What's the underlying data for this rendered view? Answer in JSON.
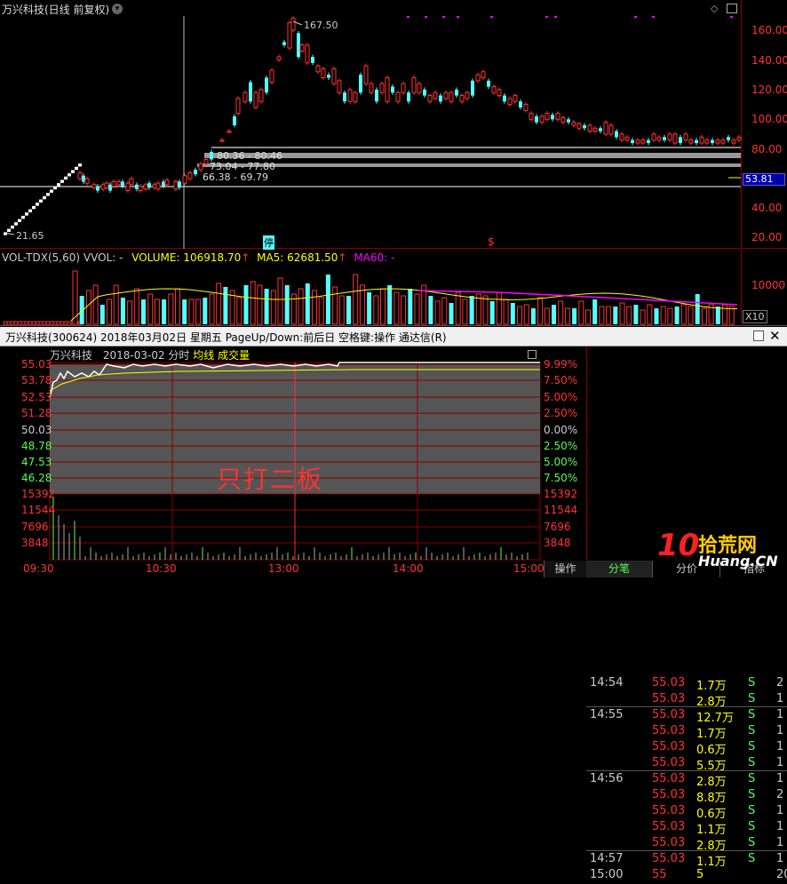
{
  "top": {
    "title": "万兴科技(日线 前复权)",
    "y_axis_ticks": [
      "160.00",
      "140.00",
      "120.00",
      "100.00",
      "80.00",
      "60.00",
      "40.00",
      "20.00"
    ],
    "last_price_tag": "53.81",
    "annotations": {
      "high": "167.50",
      "low": "21.65",
      "gap1": "80.36 - 80.46",
      "gap2": "73.04 - 77.80",
      "gap3": "66.38 - 69.79"
    },
    "markers": {
      "stop": "停",
      "dollar": "$"
    }
  },
  "volume": {
    "label_name": "VOL-TDX(5,60)",
    "label_vvol": "VVOL: -",
    "label_volume": "VOLUME: 106918.70",
    "label_ma5": "MA5: 62681.50",
    "label_ma60": "MA60: -",
    "y_tick": "10000",
    "unit": "X10"
  },
  "window": {
    "title": "万兴科技(300624) 2018年03月02日 星期五 PageUp/Down:前后日 空格键:操作 通达信(R)"
  },
  "intraday": {
    "stock": "万兴科技",
    "date_label": "2018-03-02 分时",
    "avg_label": "均线",
    "vol_label": "成交量",
    "watermark": "只打二板",
    "left_ticks": [
      "55.03",
      "53.78",
      "52.53",
      "51.28",
      "50.03",
      "48.78",
      "47.53",
      "46.28",
      "15392",
      "11544",
      "7696",
      "3848"
    ],
    "right_ticks": [
      "9.99%",
      "7.50%",
      "5.00%",
      "2.50%",
      "0.00%",
      "2.50%",
      "5.00%",
      "7.50%",
      "15392",
      "11544",
      "7696",
      "3848"
    ],
    "time_ticks": [
      "09:30",
      "10:30",
      "13:00",
      "14:00",
      "15:00"
    ],
    "bottom_tab": "操作"
  },
  "trades": {
    "rows": [
      {
        "time": "14:54",
        "price": "55.03",
        "vol": "1.7万",
        "side": "S",
        "n": "2"
      },
      {
        "time": "",
        "price": "55.03",
        "vol": "2.8万",
        "side": "S",
        "n": "1"
      },
      {
        "time": "14:55",
        "price": "55.03",
        "vol": "12.7万",
        "side": "S",
        "n": "1"
      },
      {
        "time": "",
        "price": "55.03",
        "vol": "1.7万",
        "side": "S",
        "n": "1"
      },
      {
        "time": "",
        "price": "55.03",
        "vol": "0.6万",
        "side": "S",
        "n": "1"
      },
      {
        "time": "",
        "price": "55.03",
        "vol": "5.5万",
        "side": "S",
        "n": "1"
      },
      {
        "time": "14:56",
        "price": "55.03",
        "vol": "2.8万",
        "side": "S",
        "n": "1"
      },
      {
        "time": "",
        "price": "55.03",
        "vol": "8.8万",
        "side": "S",
        "n": "2"
      },
      {
        "time": "",
        "price": "55.03",
        "vol": "0.6万",
        "side": "S",
        "n": "1"
      },
      {
        "time": "",
        "price": "55.03",
        "vol": "1.1万",
        "side": "S",
        "n": "1"
      },
      {
        "time": "",
        "price": "55.03",
        "vol": "2.8万",
        "side": "S",
        "n": "1"
      },
      {
        "time": "14:57",
        "price": "55.03",
        "vol": "1.1万",
        "side": "S",
        "n": "1"
      },
      {
        "time": "15:00",
        "price": "55",
        "vol": "5",
        "side": "",
        "n": "20"
      }
    ],
    "tab_fenbi": "分笔",
    "tab_fenjia": "分价",
    "tab_zhibiao": "指标"
  },
  "watermark_logo": {
    "text1": "10",
    "text2": "拾荒网",
    "text3": "Huang.CN"
  },
  "colors": {
    "up": "#ff3232",
    "down": "#54ffff",
    "yellow": "#ffff00",
    "magenta": "#ff00ff",
    "grid": "#8b0000",
    "white": "#ffffff"
  }
}
